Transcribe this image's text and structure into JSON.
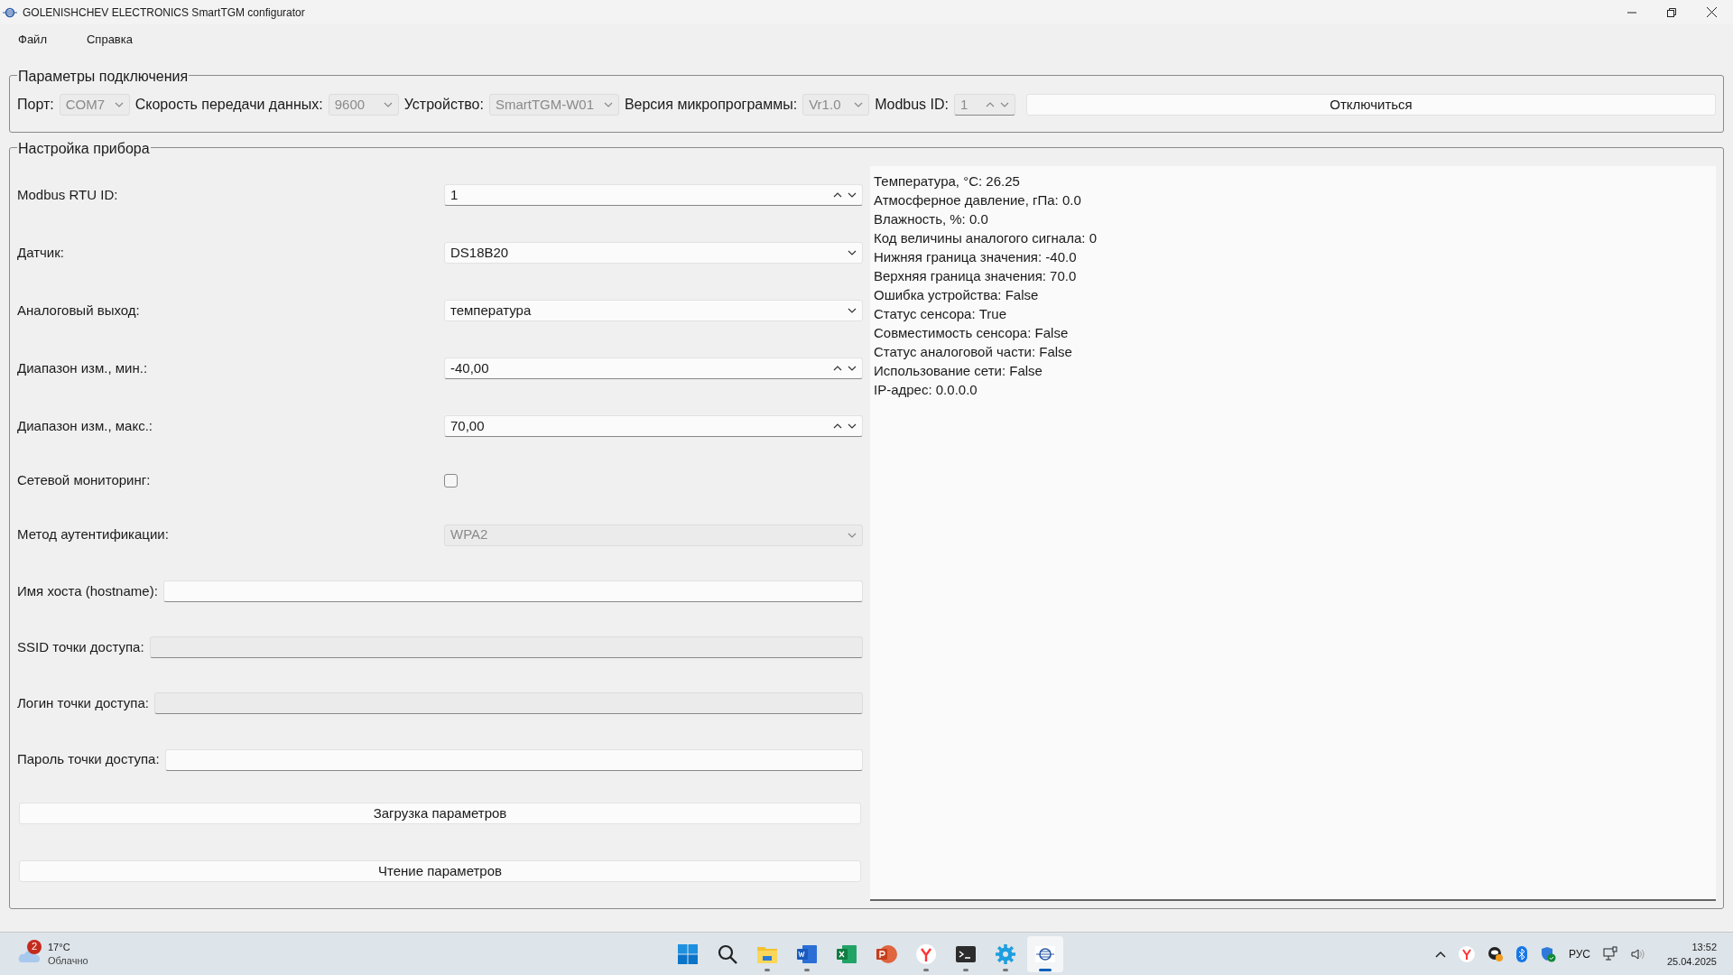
{
  "window": {
    "title": "GOLENISHCHEV ELECTRONICS SmartTGM configurator"
  },
  "menu": [
    {
      "label": "Файл"
    },
    {
      "label": "Справка"
    }
  ],
  "connection": {
    "title": "Параметры подключения",
    "fields": [
      {
        "label": "Порт:",
        "kind": "combo",
        "value": "COM7",
        "disabled": true
      },
      {
        "label": "Скорость передачи данных:",
        "kind": "combo",
        "value": "9600",
        "disabled": true
      },
      {
        "label": "Устройство:",
        "kind": "combo",
        "value": "SmartTGM-W01",
        "disabled": true
      },
      {
        "label": "Версия микропрограммы:",
        "kind": "combo",
        "value": "Vr1.0",
        "disabled": true
      },
      {
        "label": "Modbus ID:",
        "kind": "spin",
        "value": "1",
        "disabled": true
      }
    ],
    "button": "Отключиться"
  },
  "settings": {
    "title": "Настройка прибора",
    "fields": [
      {
        "label": "Modbus RTU ID:",
        "kind": "spin",
        "value": "1",
        "disabled": false
      },
      {
        "label": "Датчик:",
        "kind": "combo",
        "value": "DS18B20",
        "disabled": false
      },
      {
        "label": "Аналоговый выход:",
        "kind": "combo",
        "value": "температура",
        "disabled": false
      },
      {
        "label": "Диапазон изм., мин.:",
        "kind": "spin",
        "value": "-40,00",
        "disabled": false
      },
      {
        "label": "Диапазон изм., макс.:",
        "kind": "spin",
        "value": "70,00",
        "disabled": false
      },
      {
        "label": "Сетевой мониторинг:",
        "kind": "checkbox",
        "checked": false
      },
      {
        "label": "Метод аутентификации:",
        "kind": "combo",
        "value": "WPA2",
        "disabled": true
      },
      {
        "label": "Имя хоста (hostname):",
        "kind": "text",
        "disabled": false
      },
      {
        "label": "SSID точки доступа:",
        "kind": "text",
        "disabled": true
      },
      {
        "label": "Логин точки доступа:",
        "kind": "text",
        "disabled": true
      },
      {
        "label": "Пароль точки доступа:",
        "kind": "text",
        "disabled": false
      }
    ],
    "buttons": [
      "Загрузка параметров",
      "Чтение параметров"
    ],
    "readout": [
      "Температура, °C: 26.25",
      "Атмосферное давление, гПа: 0.0",
      "Влажность, %: 0.0",
      "Код величины аналогого сигнала: 0",
      "Нижняя граница значения: -40.0",
      "Верхняя граница значения: 70.0",
      "Ошибка устройства: False",
      "Статус сенсора: True",
      "Совместимость сенсора: False",
      "Статус аналоговой части: False",
      "Использование сети: False",
      "IP-адрес: 0.0.0.0"
    ]
  },
  "taskbar": {
    "weather": {
      "badge": "2",
      "temperature": "17°C",
      "condition": "Облачно"
    },
    "apps": [
      {
        "kind": "start",
        "running": false,
        "selected": false
      },
      {
        "kind": "search",
        "running": false,
        "selected": false
      },
      {
        "kind": "folder",
        "running": true,
        "selected": false
      },
      {
        "kind": "word",
        "running": true,
        "selected": false
      },
      {
        "kind": "excel",
        "running": false,
        "selected": false
      },
      {
        "kind": "powerpoint",
        "running": false,
        "selected": false
      },
      {
        "kind": "browser",
        "running": true,
        "selected": false
      },
      {
        "kind": "terminal",
        "running": true,
        "selected": false
      },
      {
        "kind": "settings",
        "running": true,
        "selected": false
      },
      {
        "kind": "configurator",
        "running": true,
        "selected": true
      }
    ],
    "language": "РУС",
    "time": "13:52",
    "date": "25.04.2025"
  }
}
